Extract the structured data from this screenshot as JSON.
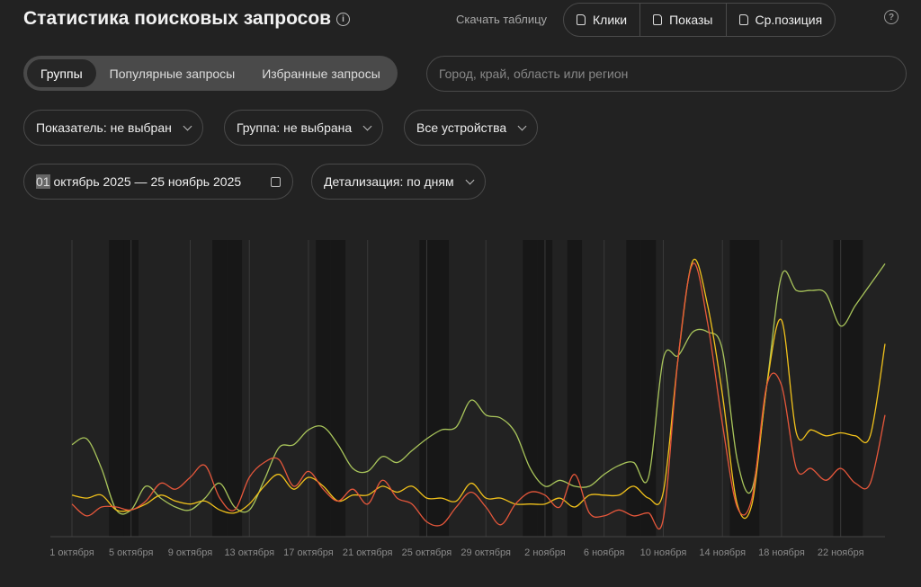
{
  "header": {
    "title": "Статистика поисковых запросов",
    "download_label": "Скачать таблицу",
    "downloads": [
      "Клики",
      "Показы",
      "Ср.позиция"
    ]
  },
  "tabs": [
    {
      "label": "Группы",
      "active": true
    },
    {
      "label": "Популярные запросы"
    },
    {
      "label": "Избранные запросы"
    }
  ],
  "region_search": {
    "placeholder": "Город, край, область или регион",
    "value": ""
  },
  "filters": {
    "indicator": "Показатель: не выбран",
    "group": "Группа: не выбрана",
    "devices": "Все устройства"
  },
  "date_range": {
    "day_selected": "01",
    "rest": " октябрь 2025 — 25 ноябрь 2025"
  },
  "detail": "Детализация: по дням",
  "chart_data": {
    "type": "line",
    "x_start": "1 октября",
    "days": 56,
    "tick_labels": [
      "1 октября",
      "5 октября",
      "9 октября",
      "13 октября",
      "17 октября",
      "21 октября",
      "25 октября",
      "29 октября",
      "2 ноября",
      "6 ноября",
      "10 ноября",
      "14 ноября",
      "18 ноября",
      "22 ноября"
    ],
    "tick_every_days": 4,
    "shaded_day_indices": [
      3,
      4,
      10,
      11,
      17,
      18,
      24,
      25,
      31,
      32,
      34,
      38,
      39,
      45,
      46,
      52,
      53
    ],
    "y_axis_labels": "none",
    "ylim": [
      0,
      100
    ],
    "grid": "vertical",
    "series": [
      {
        "color": "#a9c55b",
        "values": [
          31,
          33,
          23,
          9,
          9,
          17,
          13,
          10,
          9,
          13,
          18,
          10,
          9,
          19,
          30,
          31,
          36,
          37,
          31,
          23,
          22,
          27,
          25,
          29,
          33,
          36,
          37,
          46,
          41,
          40,
          35,
          23,
          17,
          19,
          17,
          17,
          21,
          24,
          25,
          20,
          60,
          61,
          69,
          69,
          63,
          26,
          16,
          51,
          88,
          83,
          83,
          82,
          71,
          78,
          85,
          92
        ]
      },
      {
        "color": "#f2c21b",
        "values": [
          14,
          13,
          14,
          9,
          9,
          11,
          14,
          12,
          11,
          12,
          9,
          8,
          11,
          17,
          21,
          16,
          20,
          17,
          12,
          14,
          14,
          17,
          15,
          17,
          13,
          13,
          12,
          18,
          13,
          13,
          11,
          11,
          11,
          13,
          10,
          14,
          14,
          14,
          17,
          13,
          15,
          60,
          93,
          78,
          48,
          11,
          11,
          51,
          73,
          35,
          36,
          34,
          35,
          34,
          34,
          65
        ]
      },
      {
        "color": "#e6573b",
        "values": [
          11,
          7,
          10,
          10,
          9,
          12,
          18,
          16,
          20,
          24,
          13,
          9,
          20,
          25,
          26,
          17,
          22,
          16,
          12,
          16,
          11,
          19,
          13,
          11,
          5,
          4,
          10,
          15,
          10,
          4,
          11,
          15,
          14,
          10,
          21,
          8,
          7,
          9,
          7,
          8,
          6,
          60,
          92,
          72,
          38,
          10,
          13,
          51,
          51,
          23,
          23,
          19,
          23,
          18,
          18,
          41
        ]
      }
    ]
  }
}
